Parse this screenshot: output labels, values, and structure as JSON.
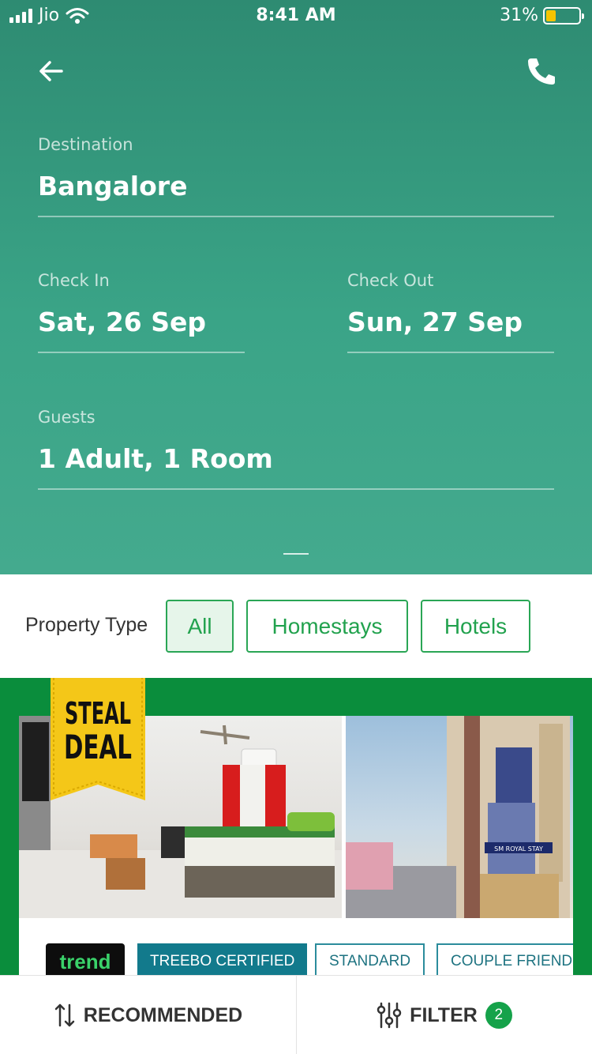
{
  "status_bar": {
    "carrier": "Jio",
    "time": "8:41 AM",
    "battery": "31%",
    "battery_level": 0.31
  },
  "search": {
    "destination_label": "Destination",
    "destination_value": "Bangalore",
    "checkin_label": "Check In",
    "checkin_value": "Sat, 26 Sep",
    "checkout_label": "Check Out",
    "checkout_value": "Sun, 27 Sep",
    "guests_label": "Guests",
    "guests_value": "1 Adult, 1 Room"
  },
  "property_type": {
    "label": "Property Type",
    "options": [
      "All",
      "Homestays",
      "Hotels"
    ],
    "selected": "All"
  },
  "listing": {
    "deal_line1": "STEAL",
    "deal_line2": "DEAL",
    "building_sign": "SM ROYAL STAY",
    "tags": [
      "trend",
      "TREEBO CERTIFIED",
      "STANDARD",
      "COUPLE FRIENDL"
    ]
  },
  "bottom_bar": {
    "sort_label": "RECOMMENDED",
    "filter_label": "FILTER",
    "filter_count": "2"
  },
  "colors": {
    "header": "#3aa487",
    "accent": "#22a24e",
    "listing_bg": "#0a8d3c",
    "tag_dark": "#127a8c"
  }
}
